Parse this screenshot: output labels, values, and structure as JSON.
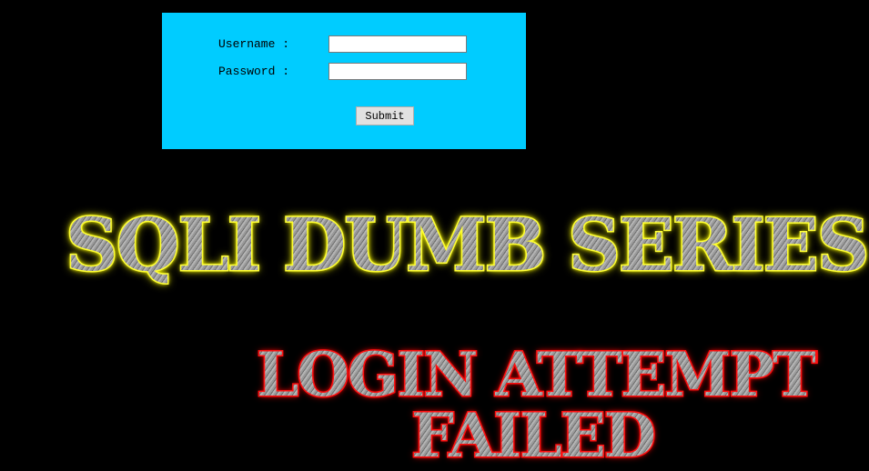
{
  "form": {
    "username_label": "Username :",
    "password_label": "Password :",
    "username_value": "",
    "password_value": "",
    "submit_label": "Submit"
  },
  "banners": {
    "title": "SQLI DUMB SERIES",
    "result_line1": "LOGIN ATTEMPT",
    "result_line2": "FAILED"
  },
  "colors": {
    "panel_bg": "#00ccff",
    "page_bg": "#000000",
    "title_glow": "#ffff00",
    "fail_glow": "#ff0000"
  }
}
